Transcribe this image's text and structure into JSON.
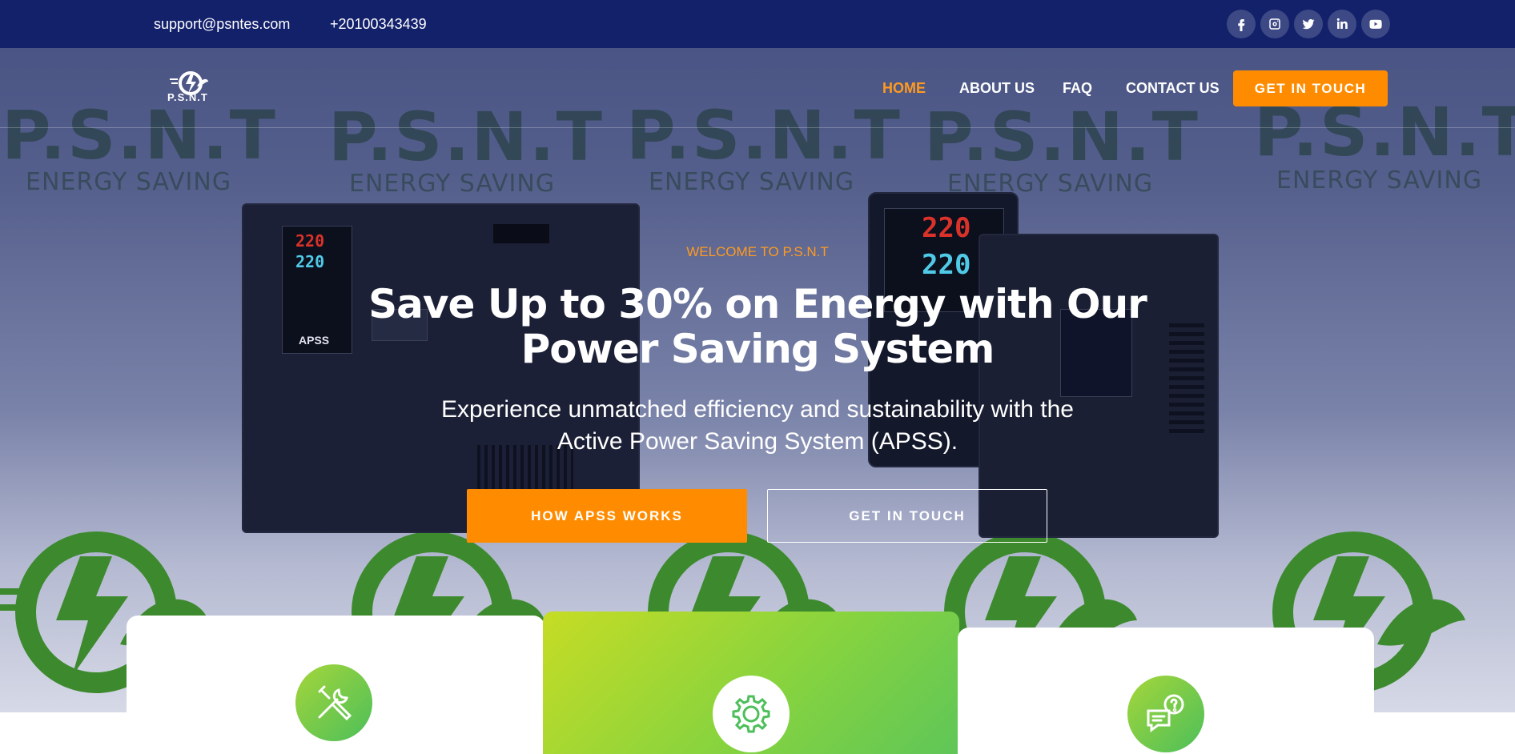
{
  "topbar": {
    "email": "support@psntes.com",
    "phone": "+20100343439",
    "socials": [
      "facebook-icon",
      "instagram-icon",
      "twitter-icon",
      "linkedin-icon",
      "youtube-icon"
    ]
  },
  "brand": {
    "logo_text": "P.S.N.T"
  },
  "nav": {
    "items": [
      "HOME",
      "ABOUT US",
      "FAQ",
      "CONTACT US"
    ],
    "active": "HOME",
    "cta": "GET IN TOUCH"
  },
  "hero": {
    "welcome": "WELCOME TO P.S.N.T",
    "headline_line1": "Save Up to 30% on Energy with Our",
    "headline_line2": "Power Saving System",
    "subline_line1": "Experience unmatched efficiency and sustainability with the",
    "subline_line2": "Active Power Saving System (APSS).",
    "primary_button": "HOW APSS WORKS",
    "secondary_button": "GET IN TOUCH",
    "watermark_big": "P.S.N.T",
    "watermark_small": "ENERGY SAVING",
    "device_label": "APSS",
    "device_reading_top": "220",
    "device_reading_bottom": "220"
  },
  "features": {
    "icons": [
      "tools-icon",
      "gear-icon",
      "support-chat-icon"
    ]
  },
  "colors": {
    "topbar": "#13216b",
    "accent": "#ff8c00",
    "active_nav": "#ff9a1f",
    "green_start": "#c6dc25",
    "green_end": "#5cc55a"
  }
}
